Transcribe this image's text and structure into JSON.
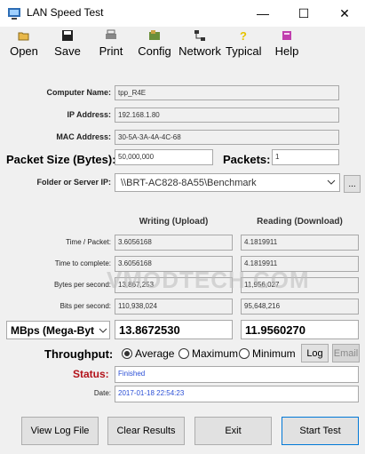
{
  "window": {
    "title": "LAN Speed Test",
    "minimize": "—",
    "maximize": "☐",
    "close": "✕"
  },
  "toolbar": [
    {
      "label": "Open",
      "icon": "open-folder-icon"
    },
    {
      "label": "Save",
      "icon": "save-disk-icon"
    },
    {
      "label": "Print",
      "icon": "printer-icon"
    },
    {
      "label": "Config",
      "icon": "config-icon"
    },
    {
      "label": "Network",
      "icon": "network-icon"
    },
    {
      "label": "Typical",
      "icon": "question-icon"
    },
    {
      "label": "Help",
      "icon": "help-book-icon"
    }
  ],
  "info": {
    "computer_name_label": "Computer Name:",
    "computer_name": "tpp_R4E",
    "ip_label": "IP Address:",
    "ip": "192.168.1.80",
    "mac_label": "MAC Address:",
    "mac": "30-5A-3A-4A-4C-68",
    "packet_size_label": "Packet Size (Bytes):",
    "packet_size": "50,000,000",
    "packets_label": "Packets:",
    "packets": "1",
    "folder_label": "Folder or Server IP:",
    "folder": "\\\\BRT-AC828-8A55\\Benchmark",
    "browse": "..."
  },
  "results": {
    "writing_header": "Writing (Upload)",
    "reading_header": "Reading (Download)",
    "rows": [
      {
        "label": "Time / Packet:",
        "write": "3.6056168",
        "read": "4.1819911"
      },
      {
        "label": "Time to complete:",
        "write": "3.6056168",
        "read": "4.1819911"
      },
      {
        "label": "Bytes per second:",
        "write": "13,867,253",
        "read": "11,956,027"
      },
      {
        "label": "Bits per second:",
        "write": "110,938,024",
        "read": "95,648,216"
      }
    ],
    "unit_select": "MBps (Mega-Byt",
    "big_write": "13.8672530",
    "big_read": "11.9560270"
  },
  "throughput": {
    "label": "Throughput:",
    "options": [
      "Average",
      "Maximum",
      "Minimum"
    ],
    "selected": "Average",
    "log": "Log",
    "email": "Email"
  },
  "status": {
    "status_label": "Status:",
    "status_value": "Finished",
    "date_label": "Date:",
    "date_value": "2017-01-18 22:54:23"
  },
  "buttons": {
    "view_log": "View Log File",
    "clear": "Clear Results",
    "exit": "Exit",
    "start": "Start Test"
  },
  "watermark": "VMODTECH.COM"
}
